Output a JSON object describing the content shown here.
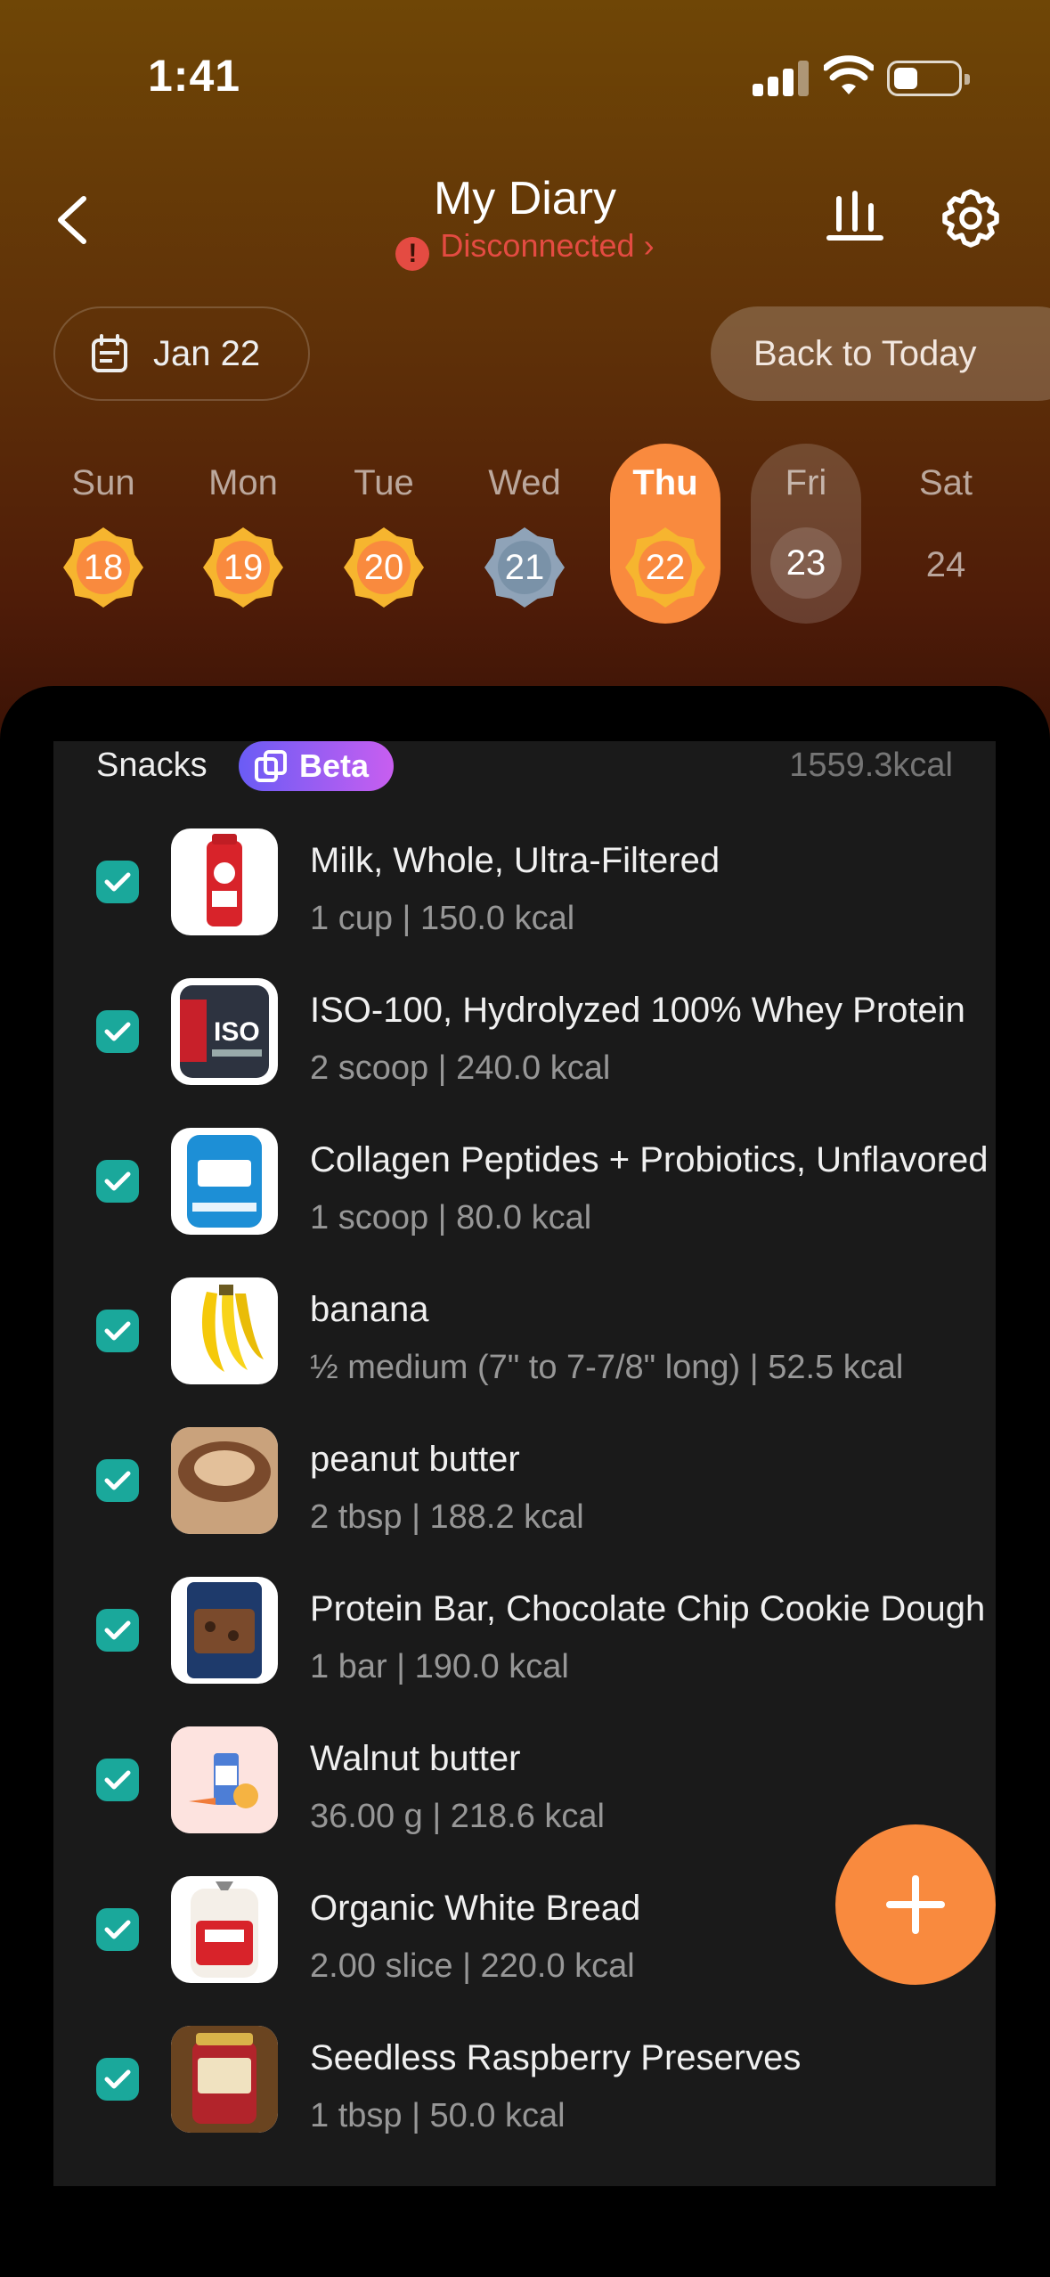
{
  "status_bar": {
    "time": "1:41"
  },
  "header": {
    "title": "My Diary",
    "connection_status": "Disconnected",
    "connection_color": "#e44b42"
  },
  "date_picker": {
    "label": "Jan 22"
  },
  "back_to_today": "Back to Today",
  "week": [
    {
      "name": "Sun",
      "date": "18",
      "state": "logged"
    },
    {
      "name": "Mon",
      "date": "19",
      "state": "logged"
    },
    {
      "name": "Tue",
      "date": "20",
      "state": "logged"
    },
    {
      "name": "Wed",
      "date": "21",
      "state": "partial"
    },
    {
      "name": "Thu",
      "date": "22",
      "state": "selected"
    },
    {
      "name": "Fri",
      "date": "23",
      "state": "future-highlight"
    },
    {
      "name": "Sat",
      "date": "24",
      "state": "future"
    }
  ],
  "meal": {
    "name": "Snacks",
    "beta_label": "Beta",
    "total": "1559.3kcal",
    "items": [
      {
        "name": "Milk, Whole, Ultra-Filtered",
        "detail": "1 cup | 150.0 kcal",
        "icon": "milk-carton",
        "checked": true
      },
      {
        "name": "ISO-100, Hydrolyzed 100% Whey Protein",
        "detail": "2 scoop | 240.0 kcal",
        "icon": "protein-tub",
        "checked": true
      },
      {
        "name": "Collagen Peptides + Probiotics, Unflavored",
        "detail": "1 scoop | 80.0 kcal",
        "icon": "collagen-jar",
        "checked": true
      },
      {
        "name": "banana",
        "detail": "½ medium (7\" to 7-7/8\" long) | 52.5 kcal",
        "icon": "banana",
        "checked": true
      },
      {
        "name": "peanut butter",
        "detail": "2 tbsp | 188.2 kcal",
        "icon": "peanut-butter",
        "checked": true
      },
      {
        "name": "Protein Bar, Chocolate Chip Cookie Dough",
        "detail": "1 bar | 190.0 kcal",
        "icon": "protein-bar-box",
        "checked": true
      },
      {
        "name": "Walnut butter",
        "detail": "36.00 g | 218.6 kcal",
        "icon": "generic-food",
        "checked": true
      },
      {
        "name": "Organic White Bread",
        "detail": "2.00 slice | 220.0 kcal",
        "icon": "bread-bag",
        "checked": true
      },
      {
        "name": "Seedless Raspberry Preserves",
        "detail": "1 tbsp | 50.0 kcal",
        "icon": "preserves-jar",
        "checked": true
      }
    ]
  },
  "colors": {
    "accent": "#f98a3e",
    "check": "#1aa89b",
    "beta_start": "#6a5cf5",
    "beta_end": "#c85ef0"
  }
}
